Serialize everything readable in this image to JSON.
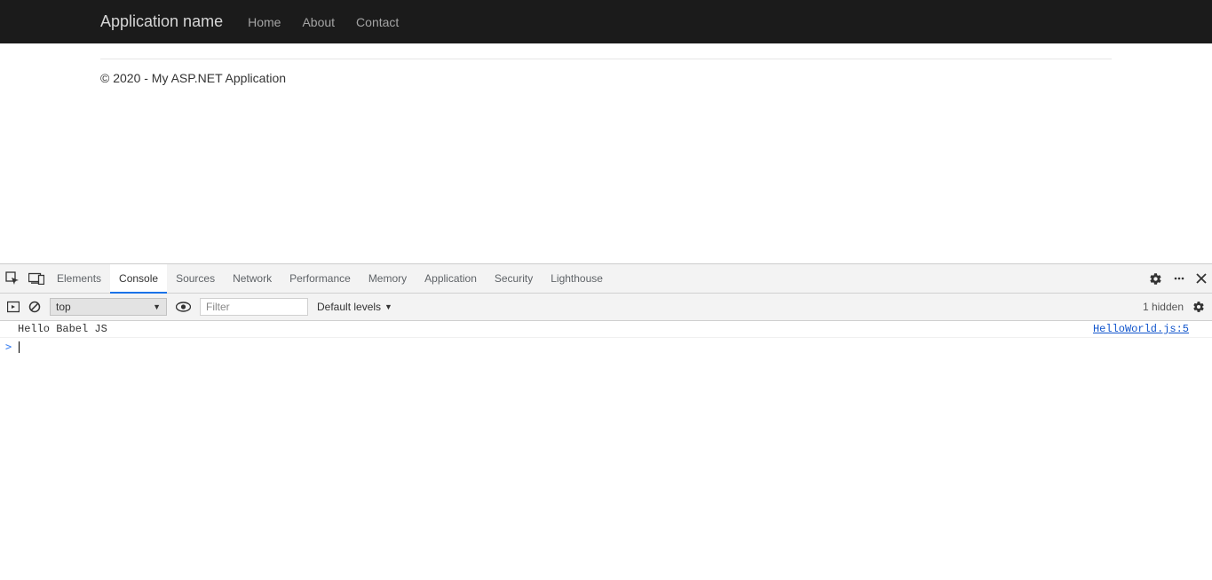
{
  "page": {
    "brand": "Application name",
    "nav": [
      "Home",
      "About",
      "Contact"
    ],
    "footer": "© 2020 - My ASP.NET Application"
  },
  "devtools": {
    "tabs": [
      "Elements",
      "Console",
      "Sources",
      "Network",
      "Performance",
      "Memory",
      "Application",
      "Security",
      "Lighthouse"
    ],
    "active_tab": "Console",
    "console_toolbar": {
      "context": "top",
      "filter_placeholder": "Filter",
      "levels_label": "Default levels",
      "hidden_label": "1 hidden"
    },
    "console_messages": [
      {
        "text": "Hello Babel JS",
        "source": "HelloWorld.js:5"
      }
    ]
  }
}
